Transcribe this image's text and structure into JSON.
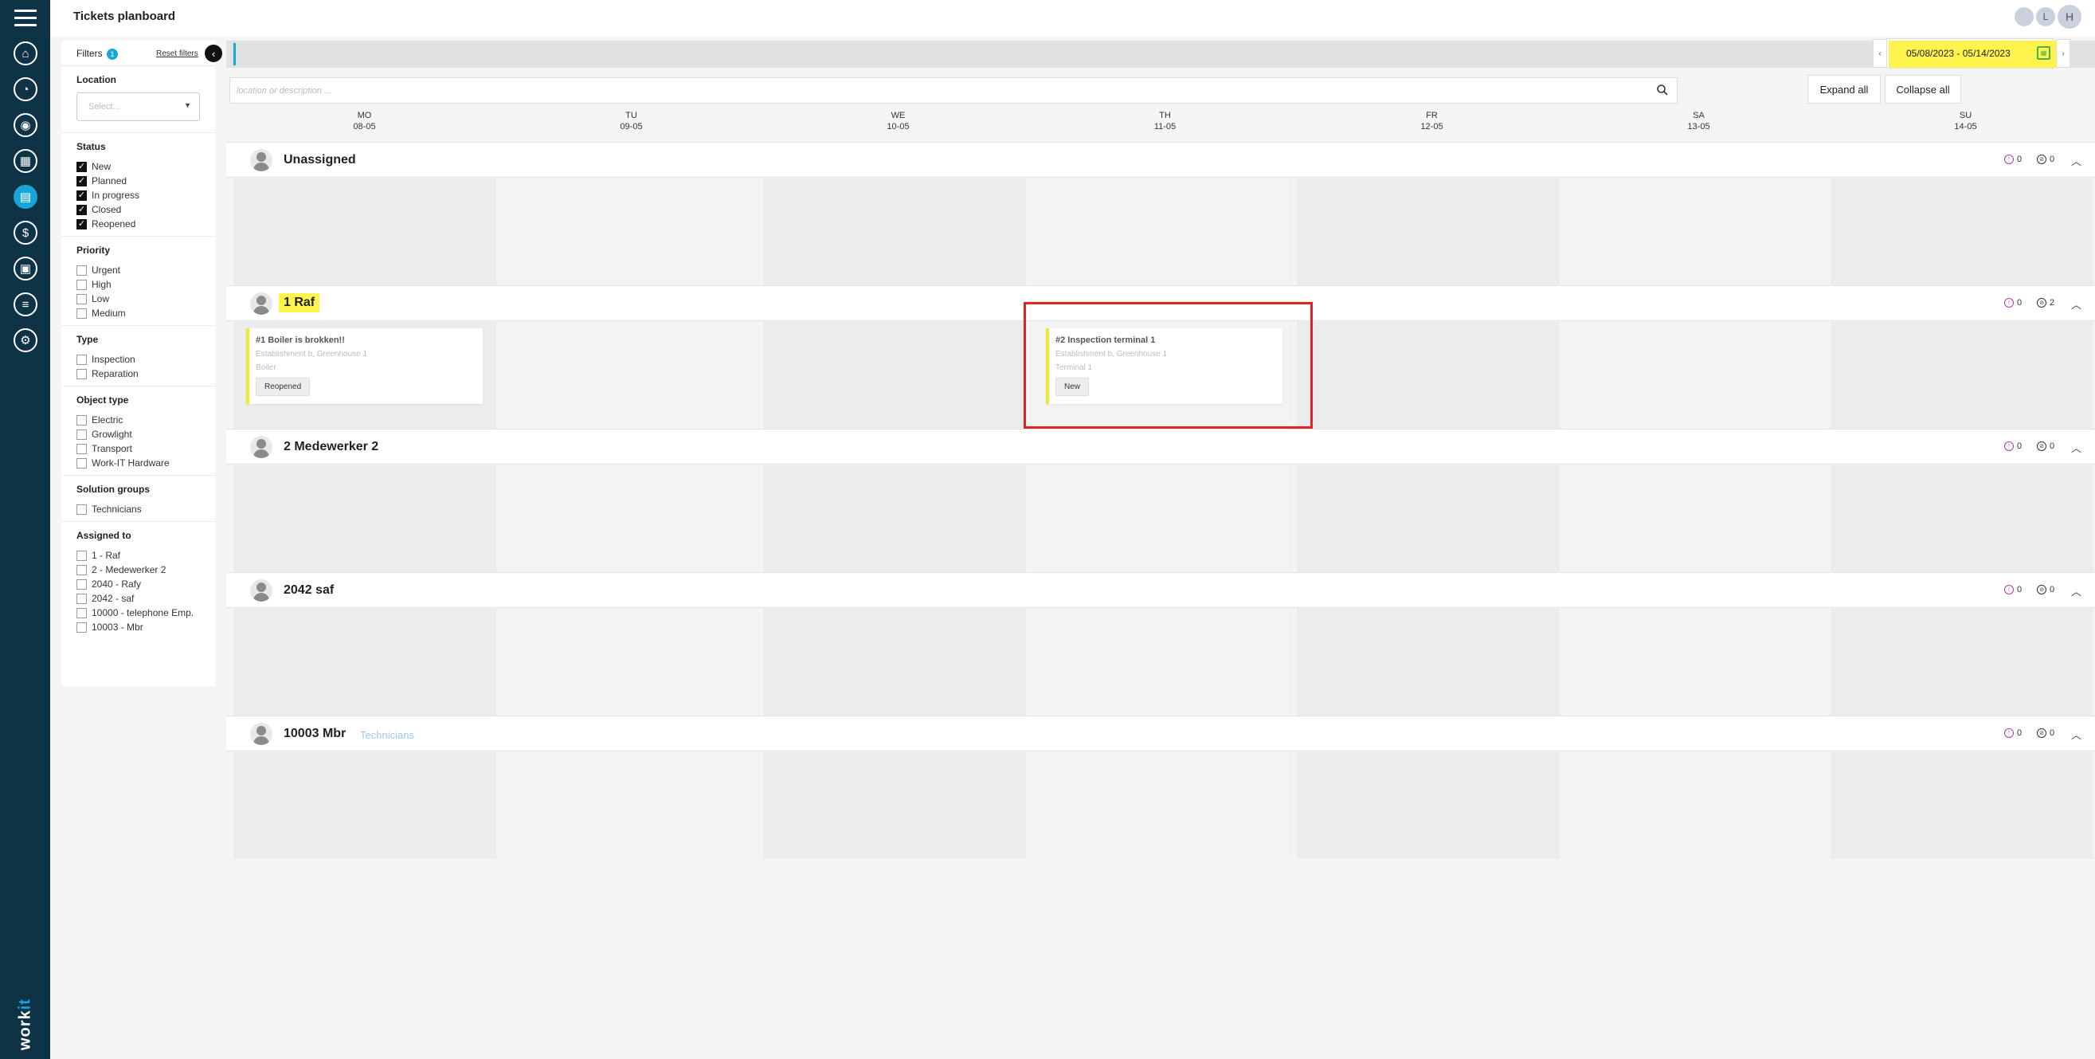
{
  "app": {
    "title": "Tickets planboard",
    "user_initials": [
      "",
      "L",
      "H"
    ],
    "logo_text_1": "work",
    "logo_text_2": "it",
    "nav_icons": [
      "home-icon",
      "dashboard-icon",
      "eye-icon",
      "calculator-icon",
      "clipboard-icon",
      "dollar-icon",
      "report-icon",
      "database-icon",
      "settings-icon"
    ]
  },
  "filters": {
    "label": "Filters",
    "count": "1",
    "reset": "Reset filters",
    "location": {
      "title": "Location",
      "placeholder": "Select..."
    },
    "status": {
      "title": "Status",
      "items": [
        {
          "label": "New",
          "checked": true
        },
        {
          "label": "Planned",
          "checked": true
        },
        {
          "label": "In progress",
          "checked": true
        },
        {
          "label": "Closed",
          "checked": true
        },
        {
          "label": "Reopened",
          "checked": true
        }
      ]
    },
    "priority": {
      "title": "Priority",
      "items": [
        "Urgent",
        "High",
        "Low",
        "Medium"
      ]
    },
    "type": {
      "title": "Type",
      "items": [
        "Inspection",
        "Reparation"
      ]
    },
    "object_type": {
      "title": "Object type",
      "items": [
        "Electric",
        "Growlight",
        "Transport",
        "Work-IT Hardware"
      ]
    },
    "solution_groups": {
      "title": "Solution groups",
      "items": [
        "Technicians"
      ]
    },
    "assigned_to": {
      "title": "Assigned to",
      "items": [
        "1 - Raf",
        "2 - Medewerker 2",
        "2040 - Rafy",
        "2042 - saf",
        "10000 - telephone Emp.",
        "10003 - Mbr"
      ]
    }
  },
  "board": {
    "date_range": "05/08/2023 - 05/14/2023",
    "search_placeholder": "location or description ...",
    "expand_all": "Expand all",
    "collapse_all": "Collapse all",
    "days": [
      {
        "dow": "MO",
        "date": "08-05"
      },
      {
        "dow": "TU",
        "date": "09-05"
      },
      {
        "dow": "WE",
        "date": "10-05"
      },
      {
        "dow": "TH",
        "date": "11-05"
      },
      {
        "dow": "FR",
        "date": "12-05"
      },
      {
        "dow": "SA",
        "date": "13-05"
      },
      {
        "dow": "SU",
        "date": "14-05"
      }
    ],
    "rows": [
      {
        "name": "Unassigned",
        "group": "",
        "count_a": "0",
        "count_b": "0"
      },
      {
        "name": "1 Raf",
        "group": "",
        "count_a": "0",
        "count_b": "2"
      },
      {
        "name": "2 Medewerker 2",
        "group": "",
        "count_a": "0",
        "count_b": "0"
      },
      {
        "name": "2042 saf",
        "group": "",
        "count_a": "0",
        "count_b": "0"
      },
      {
        "name": "10003 Mbr",
        "group": "Technicians",
        "count_a": "0",
        "count_b": "0"
      }
    ],
    "tickets": [
      {
        "title": "#1 Boiler is brokken!!",
        "location": "Establishment b, Greenhouse 1",
        "object": "Boiler",
        "status": "Reopened"
      },
      {
        "title": "#2 Inspection terminal 1",
        "location": "Establishment b, Greenhouse 1",
        "object": "Terminal 1",
        "status": "New"
      }
    ]
  },
  "colors": {
    "rail": "#0f3346",
    "accent": "#18a6d8",
    "highlight": "#fff34d",
    "ticket_border": "#f1ea2c",
    "annotation": "#e02424"
  }
}
